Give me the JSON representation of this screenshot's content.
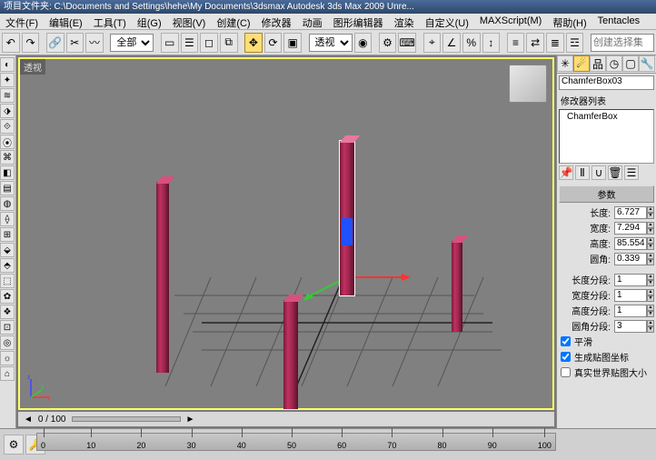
{
  "title": "项目文件夹: C:\\Documents and Settings\\hehe\\My Documents\\3dsmax    Autodesk 3ds Max 2009    Unre...",
  "menus": [
    "文件(F)",
    "编辑(E)",
    "工具(T)",
    "组(G)",
    "视图(V)",
    "创建(C)",
    "修改器",
    "动画",
    "图形编辑器",
    "渲染",
    "自定义(U)",
    "MAXScript(M)",
    "帮助(H)",
    "Tentacles"
  ],
  "toolbar": {
    "dropdown_filter": "全部",
    "search_set": "创建选择集"
  },
  "viewport": {
    "label": "透视"
  },
  "frame_display": "0 / 100",
  "timeline_ticks": [
    "0",
    "10",
    "20",
    "30",
    "40",
    "50",
    "60",
    "70",
    "80",
    "90",
    "100"
  ],
  "side": {
    "object_name": "ChamferBox03",
    "mod_list_label": "修改器列表",
    "mod_stack_top": "ChamferBox",
    "rollout_params": "参数",
    "length_label": "长度:",
    "length_val": "6.727",
    "width_label": "宽度:",
    "width_val": "7.294",
    "height_label": "高度:",
    "height_val": "85.554",
    "fillet_label": "圆角:",
    "fillet_val": "0.339",
    "lsegs_label": "长度分段:",
    "lsegs_val": "1",
    "wsegs_label": "宽度分段:",
    "wsegs_val": "1",
    "hsegs_label": "高度分段:",
    "hsegs_val": "1",
    "fsegs_label": "圆角分段:",
    "fsegs_val": "3",
    "smooth_label": "平滑",
    "genmap_label": "生成贴图坐标",
    "realworld_label": "真实世界贴图大小"
  }
}
